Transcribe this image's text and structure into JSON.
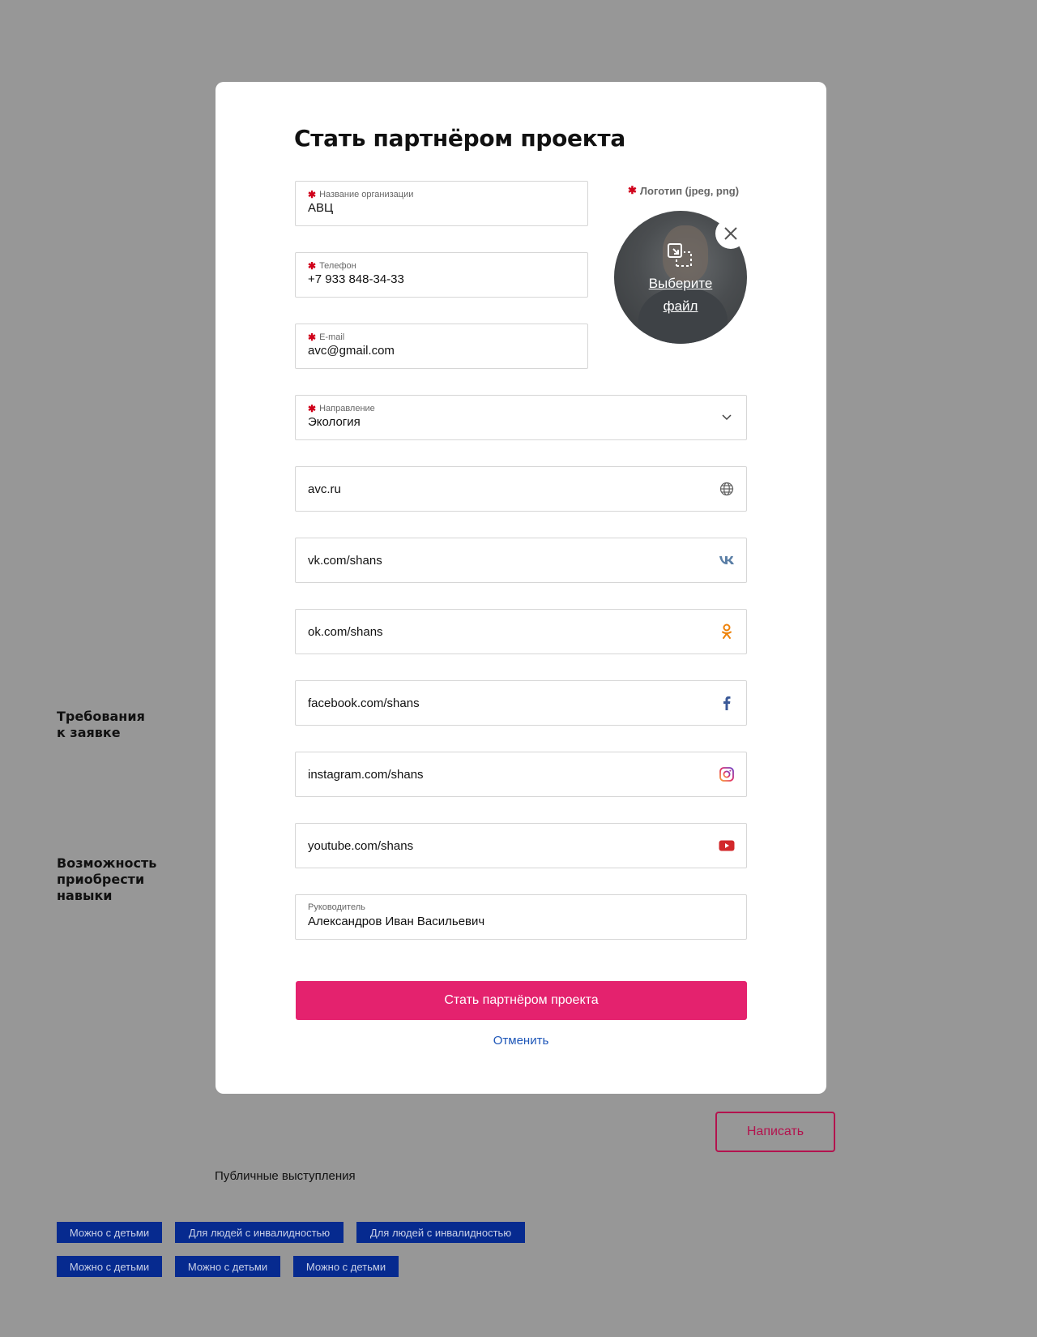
{
  "background": {
    "requirements_heading": "Требования\nк заявке",
    "skills_heading": "Возможность\nприобрести\nнавыки",
    "write_button": "Написать",
    "public_speaking": "Публичные выступления",
    "tags": [
      "Можно с детьми",
      "Для людей с инвалидностью",
      "Для людей с инвалидностью",
      "Можно с детьми",
      "Можно с детьми",
      "Можно с детьми"
    ]
  },
  "modal": {
    "title": "Стать партнёром проекта",
    "required_mark": "✱",
    "fields": {
      "org_name": {
        "label": "Название организации",
        "value": "АВЦ"
      },
      "phone": {
        "label": "Телефон",
        "value": "+7 933 848-34-33"
      },
      "email": {
        "label": "E-mail",
        "value": "avc@gmail.com"
      },
      "direction": {
        "label": "Направление",
        "value": "Экология"
      },
      "website": {
        "value": "avc.ru",
        "icon": "globe-icon"
      },
      "vk": {
        "value": "vk.com/shans",
        "icon": "vk-icon",
        "color": "#5b7fa6"
      },
      "ok": {
        "value": "ok.com/shans",
        "icon": "odnoklassniki-icon",
        "color": "#ee8208"
      },
      "facebook": {
        "value": "facebook.com/shans",
        "icon": "facebook-icon",
        "color": "#3b5998"
      },
      "instagram": {
        "value": "instagram.com/shans",
        "icon": "instagram-icon"
      },
      "youtube": {
        "value": "youtube.com/shans",
        "icon": "youtube-icon",
        "color": "#d2282b"
      },
      "manager": {
        "label": "Руководитель",
        "value": "Александров Иван Васильевич"
      }
    },
    "logo": {
      "label": "Логотип (jpeg, png)",
      "upload_text_line1": "Выберите",
      "upload_text_line2": "файл"
    },
    "submit_label": "Стать партнёром проекта",
    "cancel_label": "Отменить",
    "accent_color": "#e4226e",
    "link_color": "#1d56b8"
  }
}
